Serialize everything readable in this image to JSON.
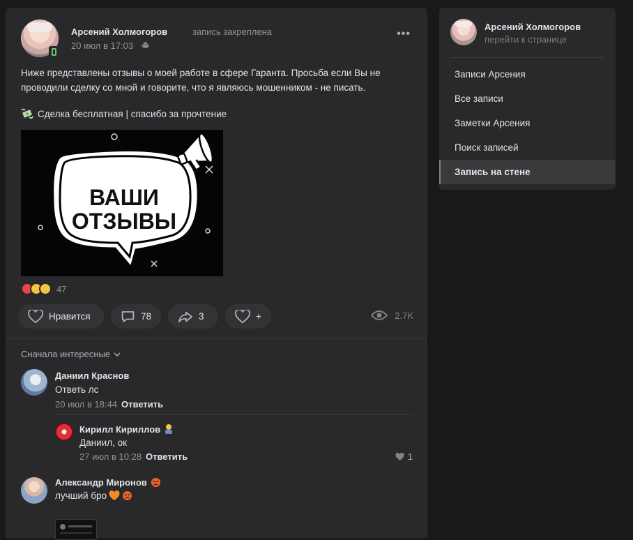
{
  "post": {
    "author": "Арсений Холмогоров",
    "pinned_label": "запись закреплена",
    "date": "20 июл в 17:03",
    "text_line1": "Ниже представлены отзывы о моей работе в сфере Гаранта. Просьба если Вы не",
    "text_line2": "проводили сделку со мной и говорите, что я являюсь мошенником - не писать.",
    "text_line3": "Сделка бесплатная | спасибо за прочтение",
    "image_text_line1": "ВАШИ",
    "image_text_line2": "ОТЗЫВЫ",
    "reactions_count": "47",
    "like_label": "Нравится",
    "comments_count": "78",
    "shares_count": "3",
    "add_reaction_label": "+",
    "views": "2.7K"
  },
  "comments": {
    "sort_label": "Сначала интересные",
    "reply_label": "Ответить",
    "items": [
      {
        "name": "Даниил Краснов",
        "text": "Ответь лс",
        "date": "20 июл в 18:44"
      },
      {
        "name": "Кирилл Кириллов",
        "text": "Даниил, ок",
        "date": "27 июл в 10:28",
        "likes": "1"
      },
      {
        "name": "Александр Миронов",
        "text": "лучший бро"
      }
    ]
  },
  "sidebar": {
    "name": "Арсений Холмогоров",
    "link": "перейти к странице",
    "items": [
      {
        "label": "Записи Арсения"
      },
      {
        "label": "Все записи"
      },
      {
        "label": "Заметки Арсения"
      },
      {
        "label": "Поиск записей"
      },
      {
        "label": "Запись на стене",
        "active": true
      }
    ]
  },
  "colors": {
    "background": "#19191a",
    "card": "#29292b",
    "button": "#333336",
    "text": "#e1e3e6",
    "muted": "#939393",
    "like_red": "#e64646"
  }
}
